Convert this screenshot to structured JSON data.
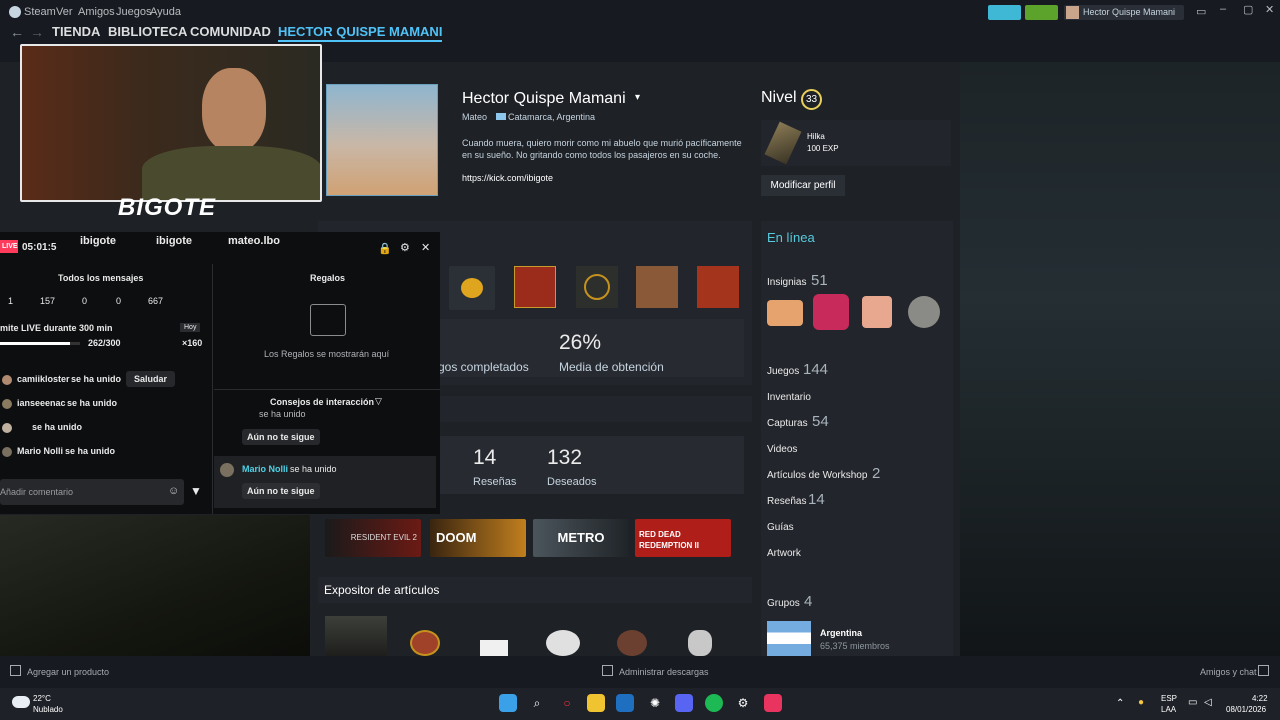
{
  "menubar": {
    "steam": "Steam",
    "ver": "Ver",
    "amigos": "Amigos",
    "juegos": "Juegos",
    "ayuda": "Ayuda",
    "user": "Hector Quispe Mamani"
  },
  "nav": {
    "tienda": "TIENDA",
    "biblioteca": "BIBLIOTECA",
    "comunidad": "COMUNIDAD",
    "user": "HECTOR QUISPE MAMANI"
  },
  "stream": {
    "logo": "BIGOTE",
    "live": "LIVE",
    "timer": "05:01:5",
    "socials": [
      "ibigote",
      "ibigote",
      "mateo.lbo"
    ],
    "all_messages": "Todos los mensajes",
    "stats": [
      "1",
      "157",
      "0",
      "0",
      "667"
    ],
    "goal_text": "mite LIVE durante 300 min",
    "goal_badge": "Hoy",
    "goal_progress": "262/300",
    "goal_fraction": 0.873,
    "goal_reward": "×160",
    "joins": [
      {
        "user": "camiikloster",
        "text": "se ha unido"
      },
      {
        "user": "ianseeenac",
        "text": "se ha unido"
      },
      {
        "user": "",
        "text": "se ha unido"
      },
      {
        "user": "Mario Nolli",
        "text": "se ha unido"
      }
    ],
    "greet_button": "Saludar",
    "comment_placeholder": "Añadir comentario",
    "gifts_title": "Regalos",
    "gifts_empty": "Los Regalos se mostrarán aquí",
    "tips_title": "Consejos de interacción",
    "tip1_text": "se ha unido",
    "tip_follow": "Aún no te sigue",
    "tip2_user": "Mario Nolli",
    "tip2_text": "se ha unido"
  },
  "profile": {
    "name": "Hector Quispe Mamani",
    "realname": "Mateo",
    "location": "Catamarca, Argentina",
    "bio": "Cuando muera, quiero morir como mi abuelo que murió pacíficamente en su sueño. No gritando como todos los pasajeros en su coche.",
    "link": "https://kick.com/ibigote",
    "level_label": "Nivel",
    "level": "33",
    "badge_name": "Hilka",
    "badge_exp": "100 EXP",
    "edit_button": "Modificar perfil",
    "completed_label": "gos completados",
    "avg_pct": "26%",
    "avg_label": "Media de obtención",
    "reviews": "14",
    "reviews_label": "Reseñas",
    "wishlist": "132",
    "wishlist_label": "Deseados",
    "showcase_title": "Expositor de artículos",
    "games": [
      "RESIDENT EVIL 2",
      "DOOM",
      "METRO",
      "RED DEAD REDEMPTION II"
    ]
  },
  "sidebar": {
    "online": "En línea",
    "badges_label": "Insignias",
    "badges": "51",
    "games_label": "Juegos",
    "games": "144",
    "inventory": "Inventario",
    "screens_label": "Capturas",
    "screens": "54",
    "videos": "Videos",
    "workshop_label": "Artículos de Workshop",
    "workshop": "2",
    "reviews_label": "Reseñas",
    "reviews": "14",
    "guides": "Guías",
    "artwork": "Artwork",
    "groups_label": "Grupos",
    "groups": "4",
    "group_name": "Argentina",
    "group_members": "65,375 miembros"
  },
  "bottombar": {
    "add_product": "Agregar un producto",
    "downloads": "Administrar descargas",
    "friends": "Amigos y chat"
  },
  "taskbar": {
    "temp": "22°C",
    "weather": "Nublado",
    "lang1": "ESP",
    "lang2": "LAA",
    "time": "4:22",
    "date": "08/01/2026"
  },
  "colors": {
    "accent": "#4fc3f7",
    "level": "#e8d05a",
    "nav_bg": "#171a21"
  }
}
